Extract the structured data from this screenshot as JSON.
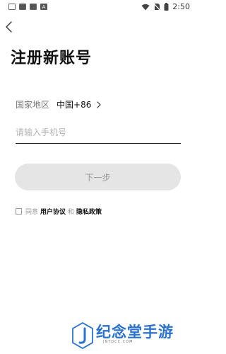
{
  "status_bar": {
    "time": "2:50",
    "left_icons": [
      "keyboard-icon",
      "square-icon",
      "square-icon",
      "a-notification-icon"
    ],
    "a_letter": "A",
    "right_icons": [
      "wifi-icon",
      "no-sim-icon",
      "battery-icon"
    ]
  },
  "page": {
    "title": "注册新账号",
    "back_icon": "chevron-left-icon"
  },
  "region": {
    "label": "国家地区",
    "value": "中国+86",
    "chevron_icon": "chevron-right-icon"
  },
  "phone": {
    "placeholder": "请输入手机号",
    "value": ""
  },
  "next_button": {
    "label": "下一步"
  },
  "agreement": {
    "checked": false,
    "prefix": "同意",
    "user_agreement": "用户协议",
    "and": "和",
    "privacy_policy": "隐私政策"
  },
  "watermark": {
    "text": "纪念堂手游",
    "sub": "JNTDCC.COM",
    "color": "#2a72d0"
  },
  "colors": {
    "accent": "#111111",
    "button_bg": "#e5e5e5",
    "button_text": "#9a9a9a",
    "placeholder": "#b3b3b3"
  }
}
